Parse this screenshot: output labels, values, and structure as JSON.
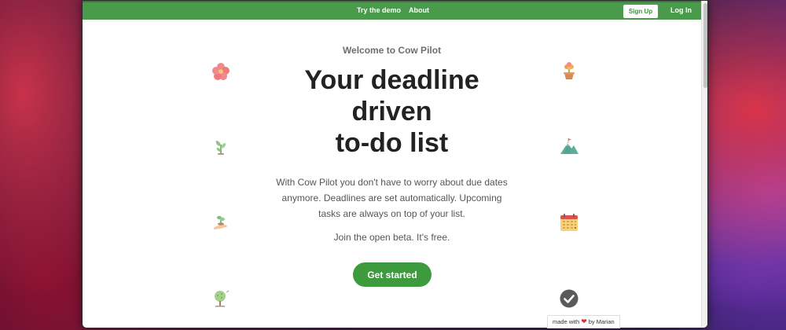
{
  "nav": {
    "try_demo": "Try the demo",
    "about": "About",
    "sign_up": "Sign Up",
    "log_in": "Log In"
  },
  "hero": {
    "welcome": "Welcome to Cow Pilot",
    "headline_lines": [
      "Your deadline",
      "driven",
      "to-do list"
    ],
    "description_lines": [
      "With Cow Pilot you don't have to worry about due dates",
      "anymore. Deadlines are set automatically. Upcoming",
      "tasks are always on top of your list."
    ],
    "beta": "Join the open beta. It's free.",
    "cta": "Get started"
  },
  "footer_badge": {
    "prefix": "made with",
    "suffix": "by Marian"
  },
  "icons": {
    "left": [
      "flower-icon",
      "sprout-icon",
      "hand-plant-icon",
      "tree-icon"
    ],
    "right": [
      "potted-flower-icon",
      "mountain-icon",
      "calendar-icon",
      "checkmark-icon"
    ]
  },
  "colors": {
    "nav_green": "#4a9a4c",
    "cta_green": "#3d9a3d",
    "heart_red": "#d93030"
  }
}
